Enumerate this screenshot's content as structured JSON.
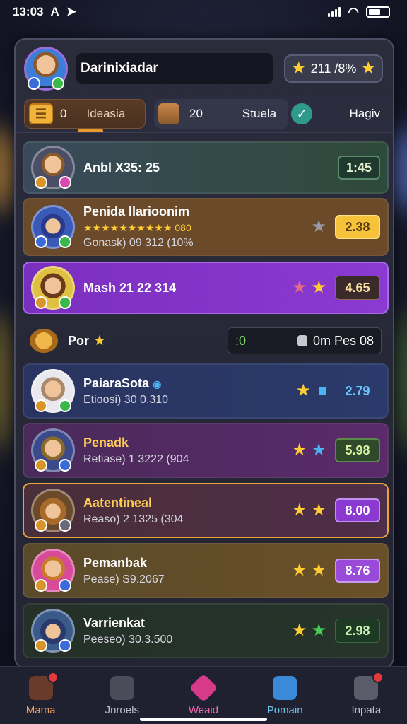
{
  "status": {
    "time": "13:03",
    "carrier_glyph": "A"
  },
  "header": {
    "username": "Darinixiadar",
    "score_value": "211 /8%"
  },
  "tabs": {
    "active_count": "0",
    "active_label": "Ideasia",
    "mid_count": "20",
    "mid_label": "Stuela",
    "right_label": "Hagiv"
  },
  "rows": [
    {
      "name": "Anbl X35: 25",
      "sub": "",
      "value": "1:45",
      "stars": []
    },
    {
      "name": "Penida Ilarioonim",
      "rating_line": "★★★★★★★★★★ 080",
      "sub": "Gonask) 09 312 (10%",
      "value": "2.38",
      "stars": [
        "grey"
      ]
    },
    {
      "name": "Mash 21 22 314",
      "sub": "",
      "value": "4.65",
      "stars": [
        "pink",
        "gold"
      ]
    },
    {
      "name": "PaiaraSota",
      "sub": "Etioosi) 30 0.310",
      "value": "2.79",
      "stars": [
        "gold",
        "blue-square"
      ]
    },
    {
      "name": "Penadk",
      "sub": "Retiase) 1 3222 (904",
      "value": "5.98",
      "stars": [
        "gold",
        "blue"
      ]
    },
    {
      "name": "Aatentineal",
      "sub": "Reaso) 2 1325 (304",
      "value": "8.00",
      "stars": [
        "gold",
        "gold"
      ]
    },
    {
      "name": "Pemanbak",
      "sub": "Pease) S9.2067",
      "value": "8.76",
      "stars": [
        "gold",
        "gold"
      ]
    },
    {
      "name": "Varrienkat",
      "sub": "Peeseo) 30.3.500",
      "value": "2.98",
      "stars": [
        "gold",
        "green"
      ]
    }
  ],
  "separator": {
    "label": "Por",
    "left_value": ":0",
    "right_label": "0m Pes 08"
  },
  "nav": [
    {
      "label": "Mama",
      "icon": "home-icon"
    },
    {
      "label": "Jnroels",
      "icon": "house-icon"
    },
    {
      "label": "Weaid",
      "icon": "check-shield-icon"
    },
    {
      "label": "Pomain",
      "icon": "ticket-icon"
    },
    {
      "label": "Inpata",
      "icon": "chat-icon"
    }
  ],
  "colors": {
    "accent": "#e89a2a",
    "purple_row": "#7b2fc0",
    "gold_value": "#f6c23a"
  }
}
